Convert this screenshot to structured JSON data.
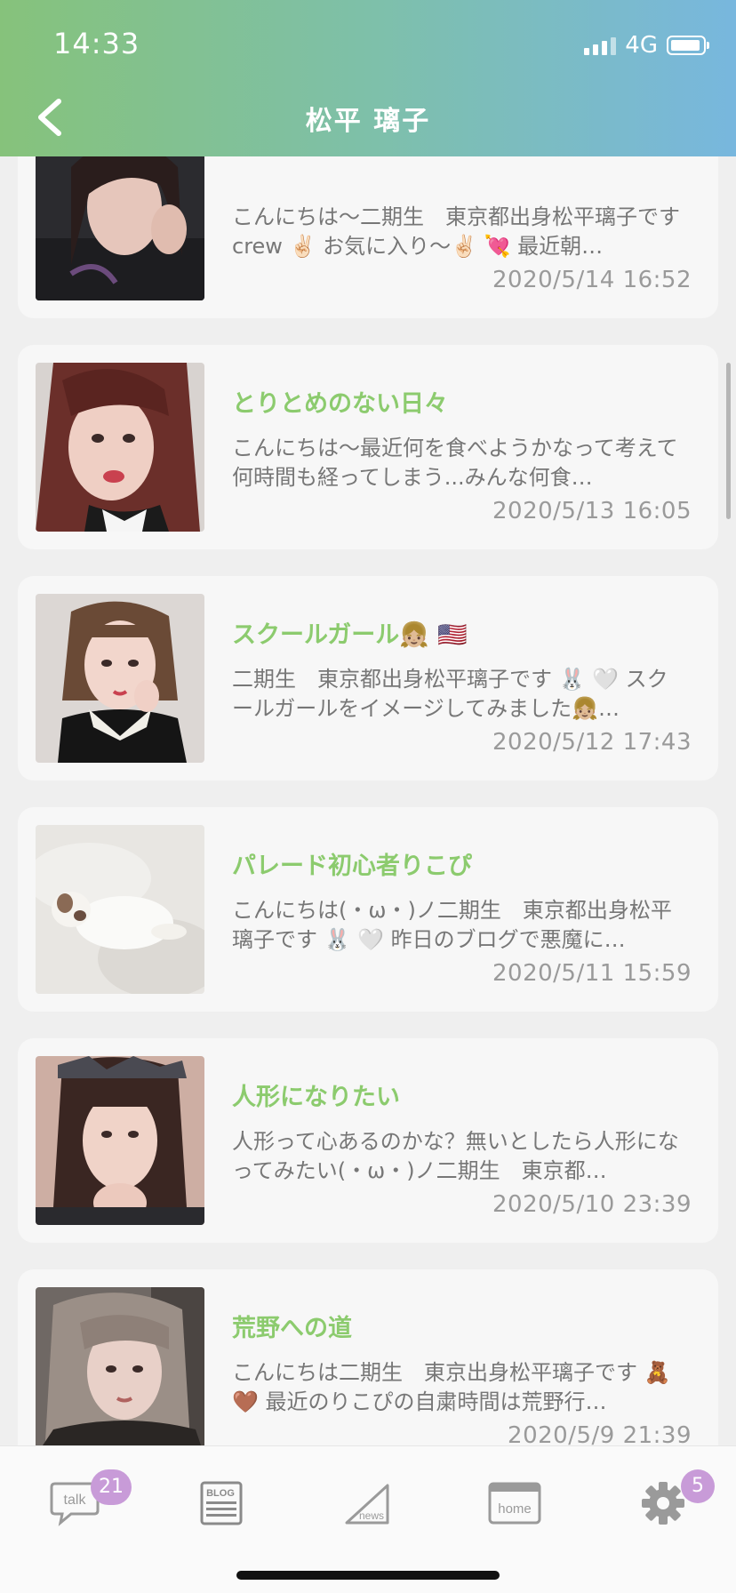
{
  "status_bar": {
    "time": "14:33",
    "network": "4G"
  },
  "header": {
    "title": "松平 璃子"
  },
  "posts": [
    {
      "title": "",
      "excerpt": "こんにちは〜二期生　東京都出身松平璃子ですcrew ✌🏻 お気に入り〜✌🏻 💘 最近朝…",
      "date": "2020/5/14 16:52"
    },
    {
      "title": "とりとめのない日々",
      "excerpt": "こんにちは〜最近何を食べようかなって考えて何時間も経ってしまう...みんな何食…",
      "date": "2020/5/13 16:05"
    },
    {
      "title": "スクールガール👧🏼 🇺🇸",
      "excerpt": "二期生　東京都出身松平璃子です 🐰 🤍 スクールガールをイメージしてみました👧🏼…",
      "date": "2020/5/12 17:43"
    },
    {
      "title": "パレード初心者りこぴ",
      "excerpt": "こんにちは(・ω・)ノ二期生　東京都出身松平璃子です 🐰 🤍 昨日のブログで悪魔に…",
      "date": "2020/5/11 15:59"
    },
    {
      "title": "人形になりたい",
      "excerpt": "人形って心あるのかな？無いとしたら人形になってみたい(・ω・)ノ二期生　東京都…",
      "date": "2020/5/10 23:39"
    },
    {
      "title": "荒野への道",
      "excerpt": "こんにちは二期生　東京出身松平璃子です 🧸 🤎 最近のりこぴの自粛時間は荒野行…",
      "date": "2020/5/9 21:39"
    }
  ],
  "tabbar": {
    "talk_label": "talk",
    "talk_badge": "21",
    "blog_label": "BLOG",
    "news_label": "news",
    "home_label": "home",
    "settings_badge": "5"
  },
  "colors": {
    "accent_green": "#8ccb6e",
    "badge_purple": "#c89bd8",
    "header_gradient_start": "#86c27b",
    "header_gradient_end": "#78b7de"
  },
  "icons": [
    "back-chevron-icon",
    "signal-icon",
    "battery-icon",
    "talk-bubble-icon",
    "blog-icon",
    "news-icon",
    "home-window-icon",
    "gear-icon"
  ]
}
